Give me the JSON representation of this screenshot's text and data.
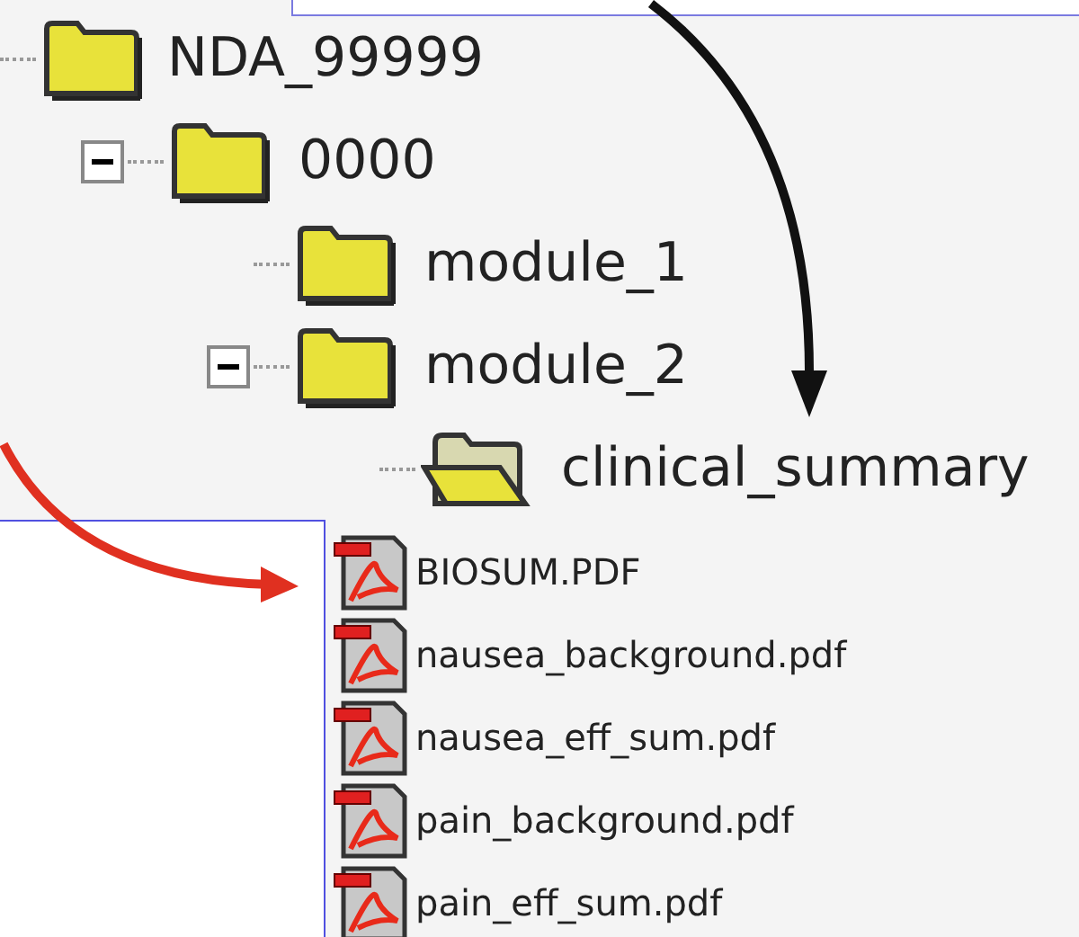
{
  "tree": [
    {
      "label": "NDA_99999",
      "kind": "folder",
      "children": [
        {
          "label": "0000",
          "kind": "folder",
          "expanded": true,
          "children": [
            {
              "label": "module_1",
              "kind": "folder"
            },
            {
              "label": "module_2",
              "kind": "folder",
              "expanded": true,
              "children": [
                {
                  "label": "clinical_summary",
                  "kind": "open-folder"
                }
              ]
            }
          ]
        }
      ]
    }
  ],
  "files": [
    {
      "label": "BIOSUM.PDF",
      "kind": "pdf"
    },
    {
      "label": "nausea_background.pdf",
      "kind": "pdf"
    },
    {
      "label": "nausea_eff_sum.pdf",
      "kind": "pdf"
    },
    {
      "label": "pain_background.pdf",
      "kind": "pdf"
    },
    {
      "label": "pain_eff_sum.pdf",
      "kind": "pdf"
    }
  ]
}
